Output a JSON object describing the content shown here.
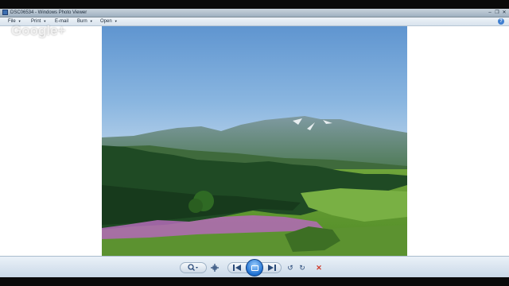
{
  "window": {
    "title": "DSC06534 - Windows Photo Viewer"
  },
  "titlebar": {
    "minimize_icon": "minimize-icon",
    "restore_icon": "restore-icon",
    "close_icon": "close-icon"
  },
  "menubar": {
    "items": [
      {
        "label": "File"
      },
      {
        "label": "Print"
      },
      {
        "label": "E-mail"
      },
      {
        "label": "Burn"
      },
      {
        "label": "Open"
      }
    ],
    "help_label": "?"
  },
  "watermark": {
    "text": "Google+"
  },
  "photo": {
    "description_icon": "landscape-photo"
  },
  "toolbar": {
    "zoom_icon": "magnifier-icon",
    "actual_size_icon": "actual-size-icon",
    "previous_icon": "previous-icon",
    "slideshow_icon": "slideshow-icon",
    "next_icon": "next-icon",
    "rotate_ccw_icon": "rotate-counterclockwise-icon",
    "rotate_cw_icon": "rotate-clockwise-icon",
    "delete_icon": "delete-icon",
    "delete_color": "#d03a2a",
    "accent_color": "#1d6fd0"
  }
}
